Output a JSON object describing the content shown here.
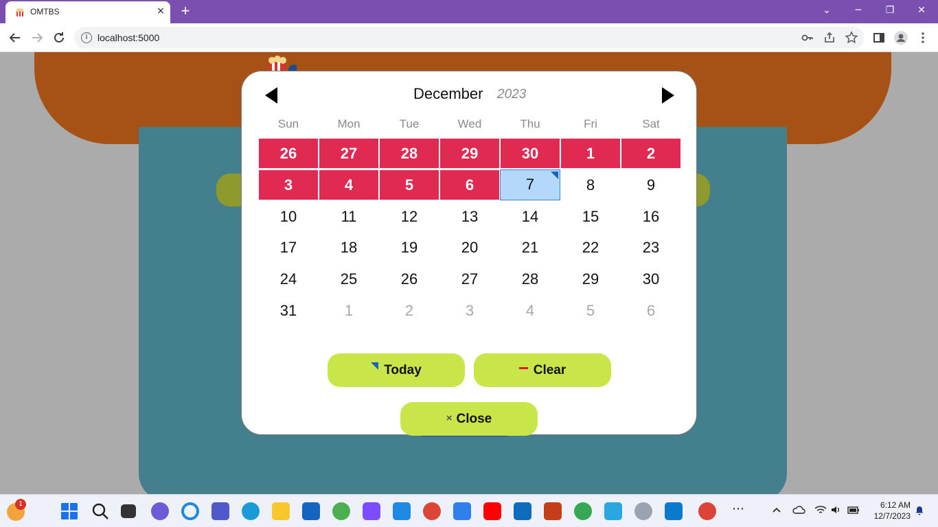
{
  "browser": {
    "tab_title": "OMTBS",
    "tab_close_icon": "×",
    "new_tab_icon": "+",
    "url": "localhost:5000",
    "window_controls": [
      "⌄",
      "─",
      "❐",
      "✕"
    ]
  },
  "calendar": {
    "month": "December",
    "year": "2023",
    "weekdays": [
      "Sun",
      "Mon",
      "Tue",
      "Wed",
      "Thu",
      "Fri",
      "Sat"
    ],
    "weeks": [
      [
        "26",
        "27",
        "28",
        "29",
        "30",
        "1",
        "2"
      ],
      [
        "3",
        "4",
        "5",
        "6",
        "7",
        "8",
        "9"
      ],
      [
        "10",
        "11",
        "12",
        "13",
        "14",
        "15",
        "16"
      ],
      [
        "17",
        "18",
        "19",
        "20",
        "21",
        "22",
        "23"
      ],
      [
        "24",
        "25",
        "26",
        "27",
        "28",
        "29",
        "30"
      ],
      [
        "31",
        "1",
        "2",
        "3",
        "4",
        "5",
        "6"
      ]
    ],
    "today_label": "Today",
    "clear_label": "Clear",
    "close_label": "Close",
    "close_icon": "×"
  },
  "taskbar": {
    "time": "6:12 AM",
    "date": "12/7/2023",
    "notification_badge": "1",
    "more_icon": "⋯"
  },
  "colors": {
    "title_bar": "#7a4fae",
    "range_highlight": "#e02a52",
    "today_highlight": "#b3d8fb",
    "button_lime": "#c8e64a"
  }
}
